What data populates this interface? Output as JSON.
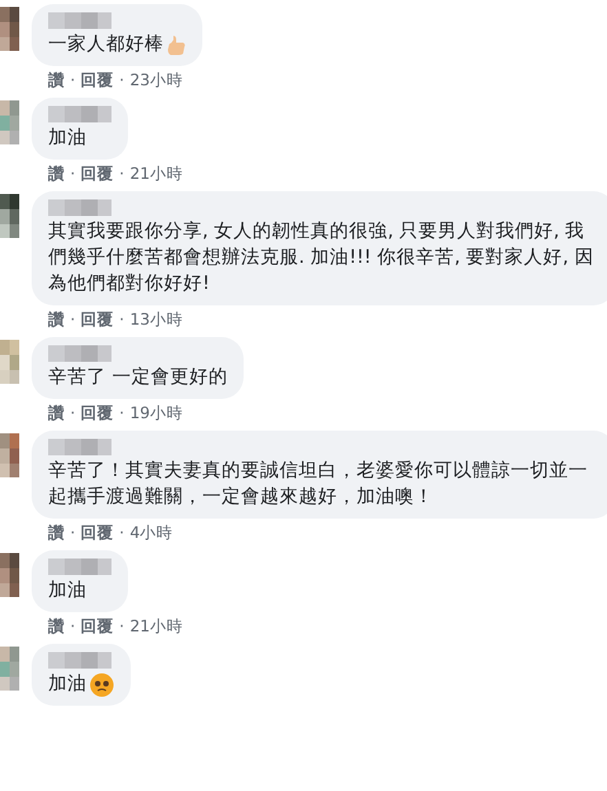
{
  "separator": "·",
  "comments": [
    {
      "text": "一家人都好棒",
      "kind": "thumbs",
      "like": "讚",
      "reply": "回覆",
      "time": "23小時"
    },
    {
      "text": "加油",
      "kind": "plain",
      "like": "讚",
      "reply": "回覆",
      "time": "21小時"
    },
    {
      "text": "其實我要跟你分享, 女人的韌性真的很強, 只要男人對我們好, 我們幾乎什麼苦都會想辦法克服. 加油!!! 你很辛苦, 要對家人好, 因為他們都對你好好!",
      "kind": "plain",
      "like": "讚",
      "reply": "回覆",
      "time": "13小時"
    },
    {
      "text": "辛苦了 一定會更好的",
      "kind": "plain",
      "like": "讚",
      "reply": "回覆",
      "time": "19小時"
    },
    {
      "text": "辛苦了！其實夫妻真的要誠信坦白，老婆愛你可以體諒一切並一起攜手渡過難關，一定會越來越好，加油噢！",
      "kind": "plain",
      "like": "讚",
      "reply": "回覆",
      "time": "4小時"
    },
    {
      "text": "加油",
      "kind": "plain",
      "like": "讚",
      "reply": "回覆",
      "time": "21小時"
    },
    {
      "text": "加油",
      "kind": "smiley"
    }
  ]
}
